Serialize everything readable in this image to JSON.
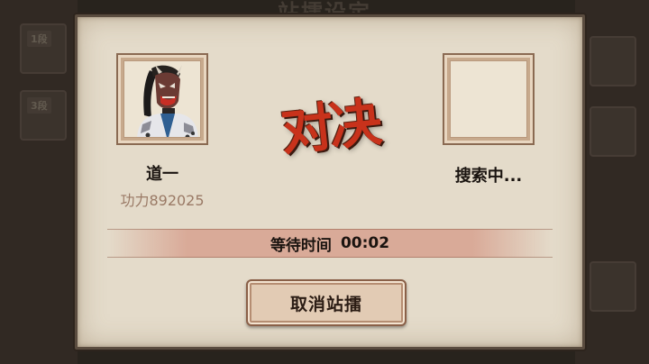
{
  "background": {
    "title": "站擂设定",
    "badges": [
      "1段",
      "3段"
    ]
  },
  "dialog": {
    "vs_label": "对决",
    "player": {
      "name": "道一",
      "power": "功力892025",
      "avatar_icon": "masked-swordsman-portrait"
    },
    "opponent": {
      "status": "搜索中..."
    },
    "wait": {
      "label": "等待时间",
      "time": "00:02"
    },
    "cancel_button": "取消站擂"
  },
  "colors": {
    "vs_red": "#c8321b",
    "parchment": "#e4dbca",
    "power_text": "#9a7a66"
  }
}
